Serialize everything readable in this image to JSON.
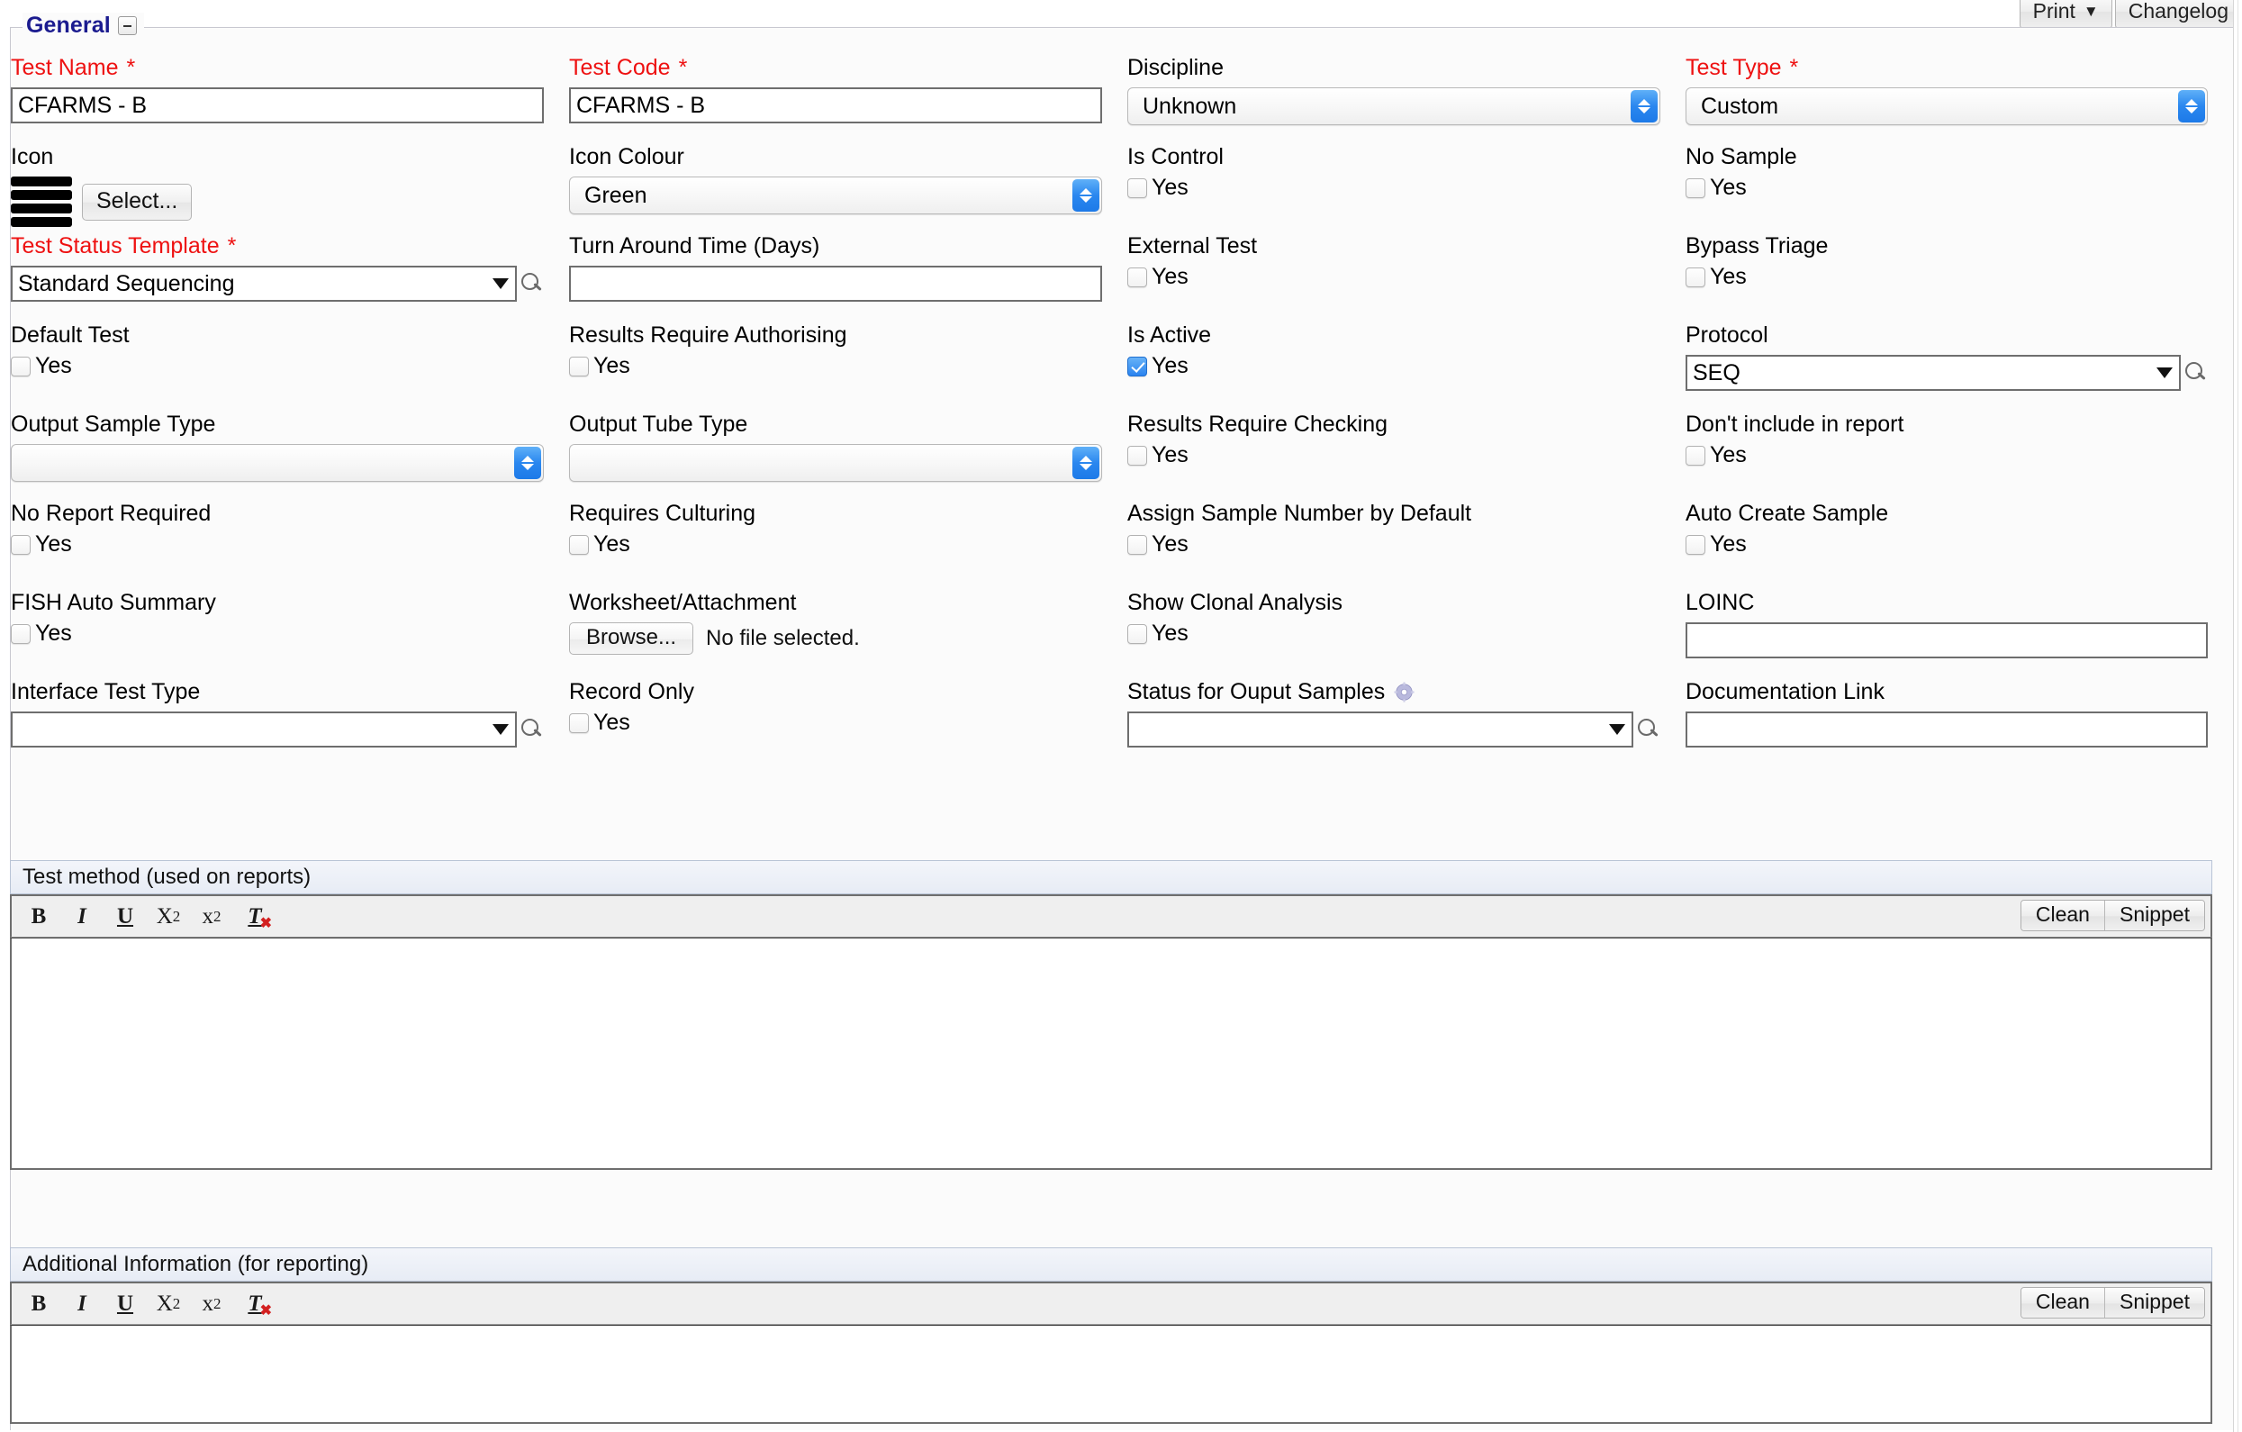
{
  "topbar": {
    "print_label": "Print",
    "print_caret": "▼",
    "changelog_label": "Changelog"
  },
  "section": {
    "legend": "General",
    "collapse_icon": "minus-icon"
  },
  "fields": {
    "test_name": {
      "label": "Test Name",
      "required": true,
      "value": "CFARMS - B"
    },
    "test_code": {
      "label": "Test Code",
      "required": true,
      "value": "CFARMS - B"
    },
    "discipline": {
      "label": "Discipline",
      "required": false,
      "value": "Unknown"
    },
    "test_type": {
      "label": "Test Type",
      "required": true,
      "value": "Custom"
    },
    "icon": {
      "label": "Icon",
      "button": "Select..."
    },
    "icon_colour": {
      "label": "Icon Colour",
      "value": "Green"
    },
    "is_control": {
      "label": "Is Control",
      "yes": "Yes",
      "checked": false
    },
    "no_sample": {
      "label": "No Sample",
      "yes": "Yes",
      "checked": false
    },
    "test_status_template": {
      "label": "Test Status Template",
      "required": true,
      "value": "Standard Sequencing"
    },
    "turn_around_time": {
      "label": "Turn Around Time (Days)",
      "value": ""
    },
    "external_test": {
      "label": "External Test",
      "yes": "Yes",
      "checked": false
    },
    "bypass_triage": {
      "label": "Bypass Triage",
      "yes": "Yes",
      "checked": false
    },
    "default_test": {
      "label": "Default Test",
      "yes": "Yes",
      "checked": false
    },
    "results_require_authorising": {
      "label": "Results Require Authorising",
      "yes": "Yes",
      "checked": false
    },
    "is_active": {
      "label": "Is Active",
      "yes": "Yes",
      "checked": true
    },
    "protocol": {
      "label": "Protocol",
      "value": "SEQ"
    },
    "output_sample_type": {
      "label": "Output Sample Type",
      "value": ""
    },
    "output_tube_type": {
      "label": "Output Tube Type",
      "value": ""
    },
    "results_require_checking": {
      "label": "Results Require Checking",
      "yes": "Yes",
      "checked": false
    },
    "dont_include_in_report": {
      "label": "Don't include in report",
      "yes": "Yes",
      "checked": false
    },
    "no_report_required": {
      "label": "No Report Required",
      "yes": "Yes",
      "checked": false
    },
    "requires_culturing": {
      "label": "Requires Culturing",
      "yes": "Yes",
      "checked": false
    },
    "assign_sample_number_by_default": {
      "label": "Assign Sample Number by Default",
      "yes": "Yes",
      "checked": false
    },
    "auto_create_sample": {
      "label": "Auto Create Sample",
      "yes": "Yes",
      "checked": false
    },
    "fish_auto_summary": {
      "label": "FISH Auto Summary",
      "yes": "Yes",
      "checked": false
    },
    "worksheet_attachment": {
      "label": "Worksheet/Attachment",
      "browse": "Browse...",
      "file_status": "No file selected."
    },
    "show_clonal_analysis": {
      "label": "Show Clonal Analysis",
      "yes": "Yes",
      "checked": false
    },
    "loinc": {
      "label": "LOINC",
      "value": ""
    },
    "interface_test_type": {
      "label": "Interface Test Type",
      "value": ""
    },
    "record_only": {
      "label": "Record Only",
      "yes": "Yes",
      "checked": false
    },
    "status_for_output_samples": {
      "label": "Status for Ouput Samples",
      "value": "",
      "gear_icon": "gear-icon"
    },
    "documentation_link": {
      "label": "Documentation Link",
      "value": ""
    }
  },
  "editors": [
    {
      "title": "Test method (used on reports)",
      "toolbar": {
        "bold": "B",
        "italic": "I",
        "underline": "U",
        "subscript_base": "X",
        "subscript_mark": "2",
        "superscript_base": "x",
        "superscript_mark": "2",
        "remove_format": "T",
        "clean": "Clean",
        "snippet": "Snippet"
      },
      "content": ""
    },
    {
      "title": "Additional Information (for reporting)",
      "toolbar": {
        "bold": "B",
        "italic": "I",
        "underline": "U",
        "subscript_base": "X",
        "subscript_mark": "2",
        "superscript_base": "x",
        "superscript_mark": "2",
        "remove_format": "T",
        "clean": "Clean",
        "snippet": "Snippet"
      },
      "content": ""
    }
  ],
  "colors": {
    "required_label": "#ee1111",
    "legend": "#1b1b8f",
    "accent_blue": "#2a83ef"
  }
}
